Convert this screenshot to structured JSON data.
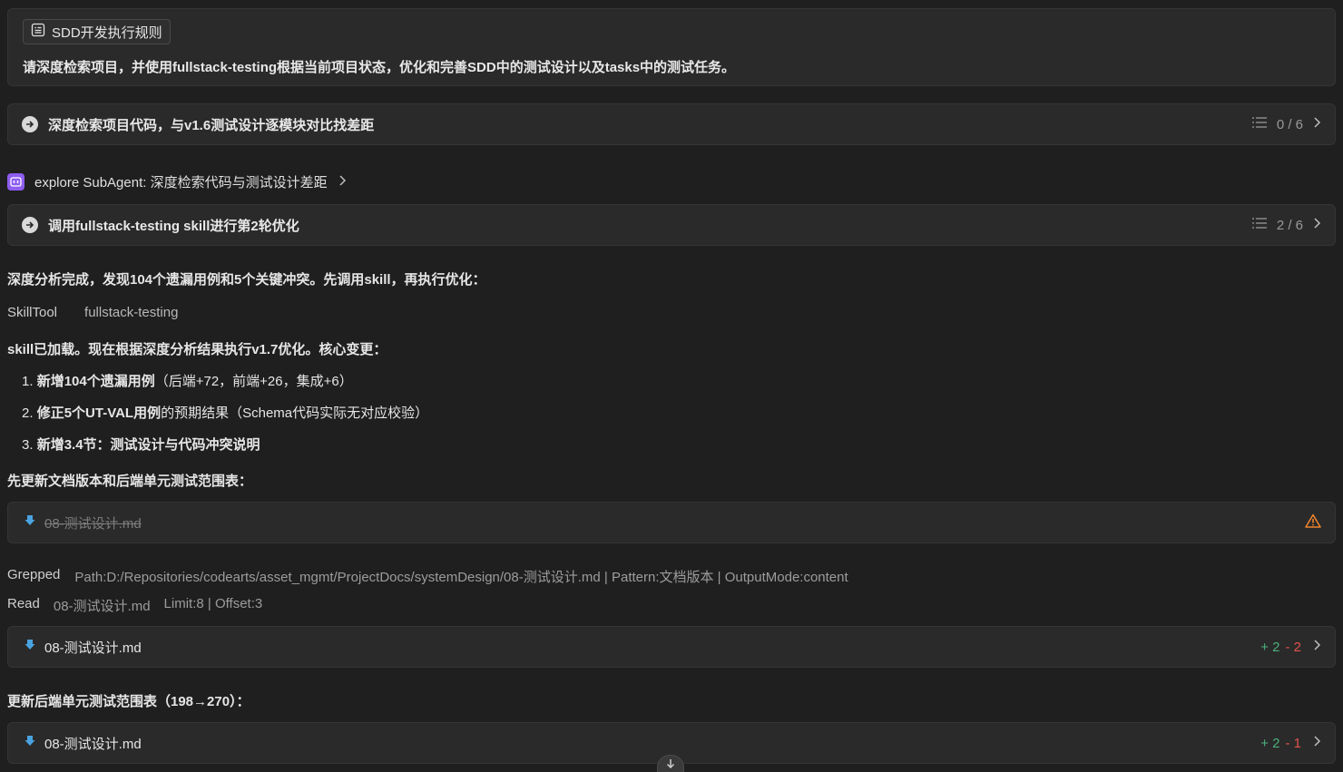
{
  "prompt": {
    "rule_label": "SDD开发执行规则",
    "text": "请深度检索项目，并使用fullstack-testing根据当前项目状态，优化和完善SDD中的测试设计以及tasks中的测试任务。"
  },
  "task1": {
    "label": "深度检索项目代码，与v1.6测试设计逐模块对比找差距",
    "progress": "0 / 6"
  },
  "subagent": {
    "label": "explore SubAgent: 深度检索代码与测试设计差距"
  },
  "task2": {
    "label": "调用fullstack-testing skill进行第2轮优化",
    "progress": "2 / 6"
  },
  "analysis_text": "深度分析完成，发现104个遗漏用例和5个关键冲突。先调用skill，再执行优化：",
  "skill_tool": {
    "name": "SkillTool",
    "value": "fullstack-testing"
  },
  "loaded_text": "skill已加载。现在根据深度分析结果执行v1.7优化。核心变更：",
  "changes": [
    {
      "num": "1.",
      "bold": "新增104个遗漏用例",
      "rest": "（后端+72，前端+26，集成+6）"
    },
    {
      "num": "2.",
      "bold": "修正5个UT-VAL用例",
      "rest": "的预期结果（Schema代码实际无对应校验）"
    },
    {
      "num": "3.",
      "bold": "新增3.4节：测试设计与代码冲突说明",
      "rest": ""
    }
  ],
  "update_text1": "先更新文档版本和后端单元测试范围表：",
  "file_failed": {
    "name": "08-测试设计.md"
  },
  "grep": {
    "label": "Grepped",
    "detail": "Path:D:/Repositories/codearts/asset_mgmt/ProjectDocs/systemDesign/08-测试设计.md | Pattern:文档版本 | OutputMode:content"
  },
  "read": {
    "label": "Read",
    "file": "08-测试设计.md",
    "detail": "Limit:8 | Offset:3"
  },
  "file_edit1": {
    "name": "08-测试设计.md",
    "add": "+ 2",
    "del": "- 2"
  },
  "update_text2": "更新后端单元测试范围表（198→270）：",
  "file_edit2": {
    "name": "08-测试设计.md",
    "add": "+ 2",
    "del": "- 1"
  },
  "colors": {
    "accent_purple": "#8e5cf0",
    "add_green": "#4caf7c",
    "del_red": "#e0524c",
    "warn_orange": "#f0852d",
    "file_blue": "#4aa3df"
  }
}
